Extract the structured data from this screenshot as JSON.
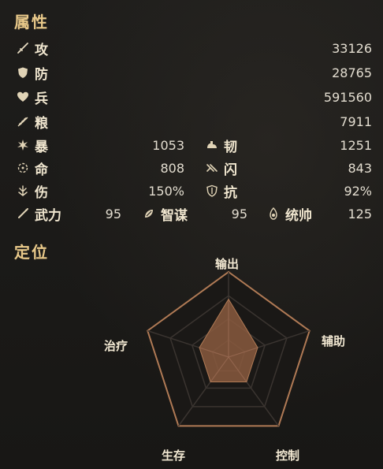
{
  "attributes": {
    "title": "属性",
    "main": [
      {
        "icon": "sword-icon",
        "label": "攻",
        "value": "33126"
      },
      {
        "icon": "shield-icon",
        "label": "防",
        "value": "28765"
      },
      {
        "icon": "heart-icon",
        "label": "兵",
        "value": "591560"
      },
      {
        "icon": "grain-icon",
        "label": "粮",
        "value": "7911"
      }
    ],
    "pairs": [
      {
        "left": {
          "icon": "burst-icon",
          "label": "暴",
          "value": "1053"
        },
        "right": {
          "icon": "muscle-icon",
          "label": "韧",
          "value": "1251"
        }
      },
      {
        "left": {
          "icon": "target-icon",
          "label": "命",
          "value": "808"
        },
        "right": {
          "icon": "dodge-icon",
          "label": "闪",
          "value": "843"
        }
      },
      {
        "left": {
          "icon": "wound-icon",
          "label": "伤",
          "value": "150%"
        },
        "right": {
          "icon": "resist-icon",
          "label": "抗",
          "value": "92%"
        }
      }
    ],
    "stats": [
      {
        "icon": "spear-icon",
        "label": "武力",
        "value": "95"
      },
      {
        "icon": "scroll-icon",
        "label": "智谋",
        "value": "95"
      },
      {
        "icon": "command-icon",
        "label": "统帅",
        "value": "125"
      }
    ]
  },
  "position": {
    "title": "定位",
    "axes": [
      "输出",
      "辅助",
      "控制",
      "生存",
      "治疗"
    ],
    "values": [
      0.68,
      0.36,
      0.36,
      0.36,
      0.36
    ],
    "colors": {
      "outline": "#b07a55",
      "fill": "#8a5a3e",
      "grid": "#3a3430"
    }
  }
}
